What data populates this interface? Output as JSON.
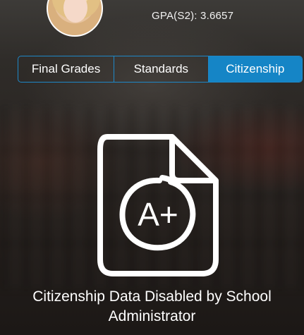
{
  "profile": {
    "gpa_text": "GPA(S2): 3.6657"
  },
  "tabs": [
    {
      "label": "Final Grades",
      "active": false
    },
    {
      "label": "Standards",
      "active": false
    },
    {
      "label": "Citizenship",
      "active": true
    }
  ],
  "main": {
    "icon": "grade-document-icon",
    "badge_text": "A+",
    "message": "Citizenship Data Disabled by School Administrator"
  },
  "colors": {
    "accent": "#1585c6",
    "tab_border": "#1e88c8",
    "text": "#ffffff"
  }
}
